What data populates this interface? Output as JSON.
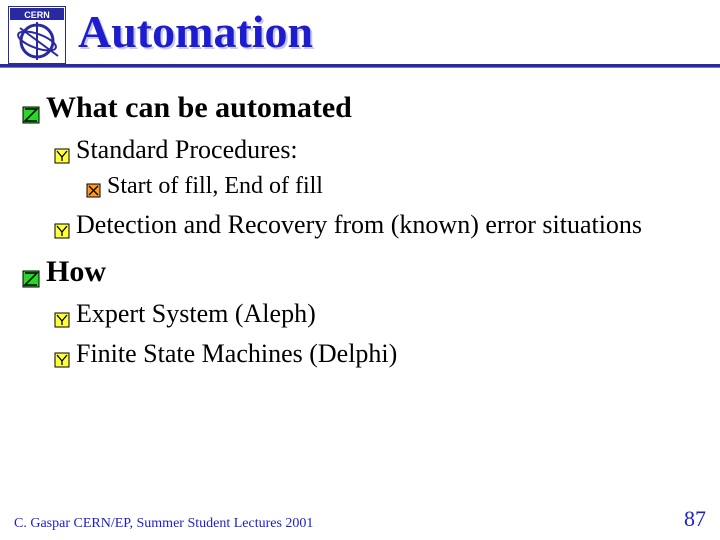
{
  "header": {
    "logo_name": "cern-logo",
    "title": "Automation"
  },
  "bullets": {
    "section1": {
      "heading": "What can be automated",
      "items": [
        {
          "label": "Standard Procedures:",
          "sub": [
            "Start of fill, End of fill"
          ]
        },
        {
          "label": "Detection and Recovery from (known) error situations"
        }
      ]
    },
    "section2": {
      "heading": "How",
      "items": [
        {
          "label": "Expert System (Aleph)"
        },
        {
          "label": "Finite State Machines (Delphi)"
        }
      ]
    }
  },
  "footer": {
    "left": "C. Gaspar CERN/EP, Summer Student Lectures 2001",
    "page": "87"
  }
}
